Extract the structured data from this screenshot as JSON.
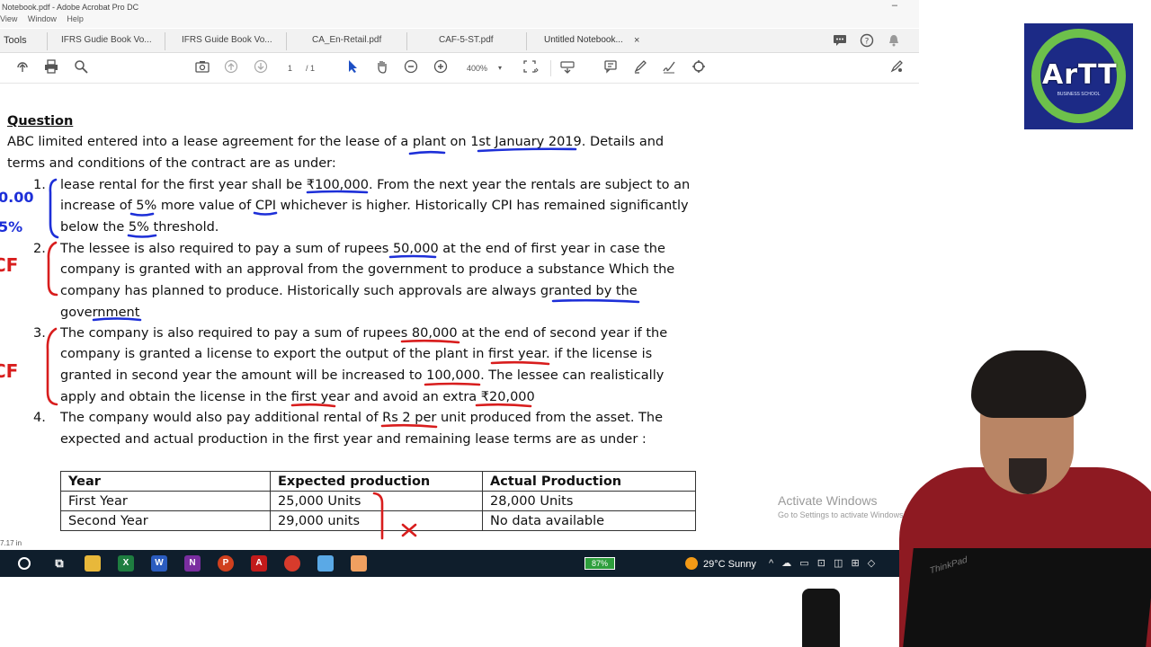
{
  "window": {
    "title": "Notebook.pdf - Adobe Acrobat Pro DC",
    "minimize_glyph": "–",
    "menu": [
      "View",
      "Window",
      "Help"
    ]
  },
  "tabs": {
    "tools_label": "Tools",
    "items": [
      {
        "label": "IFRS Gudie Book Vo..."
      },
      {
        "label": "IFRS Guide Book Vo..."
      },
      {
        "label": "CA_En-Retail.pdf"
      },
      {
        "label": "CAF-5-ST.pdf"
      },
      {
        "label": "Untitled Notebook..."
      }
    ],
    "close_glyph": "×"
  },
  "toolbar": {
    "page_current": "1",
    "page_total": "/ 1",
    "zoom": "400%"
  },
  "document": {
    "heading": "Question",
    "intro": [
      "ABC limited entered into a lease agreement for the lease of a plant on 1st January 2019. Details and",
      "terms and conditions of the contract are as under:"
    ],
    "items": [
      {
        "num": "1.",
        "lines": [
          "lease rental for the first year shall be ₹100,000. From the next year the rentals are subject to an",
          "increase of 5% more value of CPI whichever is higher. Historically CPI has remained significantly",
          "below the 5% threshold."
        ]
      },
      {
        "num": "2.",
        "lines": [
          "The lessee is also required to pay a sum of rupees 50,000 at the end of first year in case the",
          "company is granted with an approval from the government to produce a substance Which the",
          "company has planned to produce. Historically such approvals are always granted by the",
          "government"
        ]
      },
      {
        "num": "3.",
        "lines": [
          "The company is also required to pay a sum of rupees 80,000 at the end of second year if the",
          "company is granted a license to export the output of the plant in first year. if the license is",
          "granted in second year the amount will be increased to 100,000. The lessee can realistically",
          "apply and obtain the license in the first year and avoid an extra ₹20,000"
        ]
      },
      {
        "num": "4.",
        "lines": [
          "The company would also pay additional rental of Rs 2 per unit produced from the asset. The",
          "expected and actual production in the first year and remaining lease terms are as under :"
        ]
      }
    ],
    "table": {
      "headers": [
        "Year",
        "Expected production",
        "Actual Production"
      ],
      "rows": [
        [
          "First Year",
          "25,000 Units",
          "28,000 Units"
        ],
        [
          "Second Year",
          "29,000 units",
          "No data available"
        ]
      ]
    },
    "margin_notes": {
      "note_1a": "0.00",
      "note_1b": "5%",
      "note_2": "CF",
      "note_3": "CF",
      "table_mark": "×"
    }
  },
  "status_left": "7.17 in",
  "watermark": {
    "title": "Activate Windows",
    "subtitle": "Go to Settings to activate Windows."
  },
  "taskbar": {
    "battery": "87%",
    "weather": "29°C  Sunny"
  },
  "logo": {
    "word": "ArTT",
    "tagline": "BUSINESS SCHOOL"
  },
  "laptop_brand": "ThinkPad",
  "colors": {
    "pen_blue": "#1d2fd8",
    "pen_red": "#d81d1d",
    "logo_blue": "#1c2a86",
    "logo_green": "#6dc04b"
  }
}
